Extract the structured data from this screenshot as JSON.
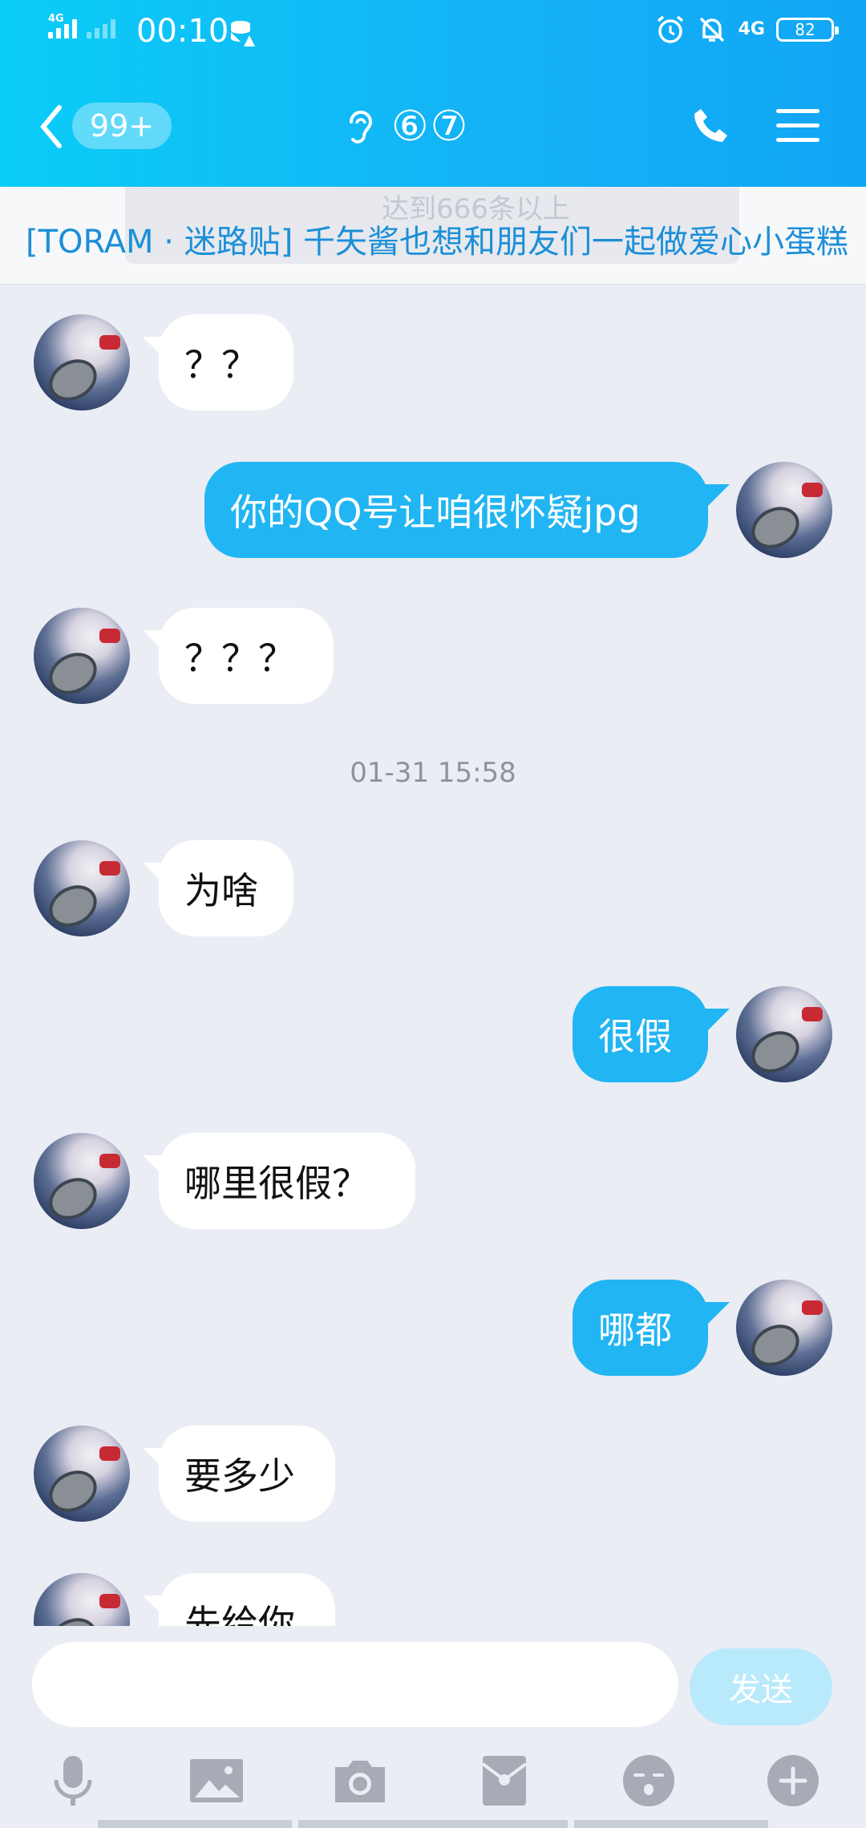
{
  "status": {
    "network_type": "4G",
    "time": "00:10",
    "right_network": "4G",
    "battery": "82"
  },
  "header": {
    "unread_badge": "99+",
    "title": "⑥⑦",
    "accent": "#12b0f5"
  },
  "notice": {
    "text": "[TORAM · 迷路贴] 千矢酱也想和朋友们一起做爱心小蛋糕",
    "ghost_text": "达到666条以上"
  },
  "messages": [
    {
      "side": "left",
      "text": "？？"
    },
    {
      "side": "right",
      "text": "你的QQ号让咱很怀疑jpg"
    },
    {
      "side": "left",
      "text": "？？？"
    },
    {
      "side": "left",
      "text": "为啥"
    },
    {
      "side": "right",
      "text": "很假"
    },
    {
      "side": "left",
      "text": "哪里很假？"
    },
    {
      "side": "right",
      "text": "哪都"
    },
    {
      "side": "left",
      "text": "要多少"
    },
    {
      "side": "left",
      "text": "先给你"
    }
  ],
  "timestamp": "01-31 15:58",
  "input": {
    "placeholder": "",
    "send_label": "发送"
  },
  "toolbar": [
    "mic-icon",
    "image-icon",
    "camera-icon",
    "red-packet-icon",
    "emoji-icon",
    "plus-icon"
  ]
}
